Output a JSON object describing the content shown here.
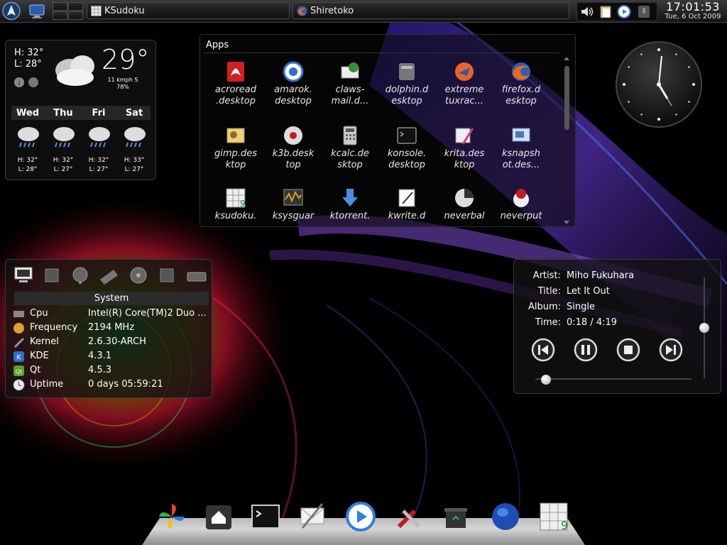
{
  "taskbar": {
    "tasks": [
      {
        "label": "KSudoku"
      },
      {
        "label": "Shiretoko"
      }
    ],
    "clock": {
      "time": "17:01:53",
      "date": "Tue, 6 Oct 2009"
    }
  },
  "weather": {
    "high": "H: 32°",
    "low": "L: 28°",
    "temp": "29°",
    "wind": "11 kmph S",
    "humidity": "78%",
    "days": [
      {
        "name": "Wed",
        "high": "H: 32°",
        "low": "L: 28°"
      },
      {
        "name": "Thu",
        "high": "H: 32°",
        "low": "L: 27°"
      },
      {
        "name": "Fri",
        "high": "H: 32°",
        "low": "L: 27°"
      },
      {
        "name": "Sat",
        "high": "H: 33°",
        "low": "L: 27°"
      }
    ]
  },
  "apps": {
    "title": "Apps",
    "items": [
      {
        "label": "acroread\n.desktop",
        "icon": "acrobat-icon"
      },
      {
        "label": "amarok.\ndesktop",
        "icon": "amarok-icon"
      },
      {
        "label": "claws-\nmail.d...",
        "icon": "claws-mail-icon"
      },
      {
        "label": "dolphin.d\nesktop",
        "icon": "dolphin-icon"
      },
      {
        "label": "extreme\ntuxrac...",
        "icon": "tuxracer-icon"
      },
      {
        "label": "firefox.d\nesktop",
        "icon": "firefox-icon"
      },
      {
        "label": "gimp.des\nktop",
        "icon": "gimp-icon"
      },
      {
        "label": "k3b.desk\ntop",
        "icon": "k3b-icon"
      },
      {
        "label": "kcalc.de\nsktop",
        "icon": "calculator-icon"
      },
      {
        "label": "konsole.\ndesktop",
        "icon": "terminal-icon"
      },
      {
        "label": "krita.des\nktop",
        "icon": "krita-icon"
      },
      {
        "label": "ksnapsh\not.des...",
        "icon": "ksnapshot-icon"
      },
      {
        "label": "ksudoku.",
        "icon": "sudoku-icon"
      },
      {
        "label": "ksysguar",
        "icon": "ksysguard-icon"
      },
      {
        "label": "ktorrent.",
        "icon": "ktorrent-icon"
      },
      {
        "label": "kwrite.d",
        "icon": "kwrite-icon"
      },
      {
        "label": "neverbal",
        "icon": "neverball-icon"
      },
      {
        "label": "neverput",
        "icon": "neverputt-icon"
      }
    ]
  },
  "system": {
    "title": "System",
    "rows": [
      {
        "key": "Cpu",
        "value": "Intel(R) Core(TM)2 Duo ...",
        "icon": "cpu-icon"
      },
      {
        "key": "Frequency",
        "value": "2194 MHz",
        "icon": "frequency-icon"
      },
      {
        "key": "Kernel",
        "value": "2.6.30-ARCH",
        "icon": "kernel-icon"
      },
      {
        "key": "KDE",
        "value": "4.3.1",
        "icon": "kde-icon"
      },
      {
        "key": "Qt",
        "value": "4.5.3",
        "icon": "qt-icon"
      },
      {
        "key": "Uptime",
        "value": "0 days 05:59:21",
        "icon": "uptime-icon"
      }
    ]
  },
  "player": {
    "artist_label": "Artist:",
    "artist": "Miho Fukuhara",
    "title_label": "Title:",
    "title": "Let It Out",
    "album_label": "Album:",
    "album": "Single",
    "time_label": "Time:",
    "time": "0:18 / 4:19",
    "progress": 0.07,
    "volume": 0.5
  },
  "dock": {
    "items": [
      "pinwheel-icon",
      "home-icon",
      "terminal-icon",
      "mail-icon",
      "media-player-icon",
      "tools-icon",
      "trash-icon",
      "globe-icon",
      "sudoku-icon"
    ]
  }
}
